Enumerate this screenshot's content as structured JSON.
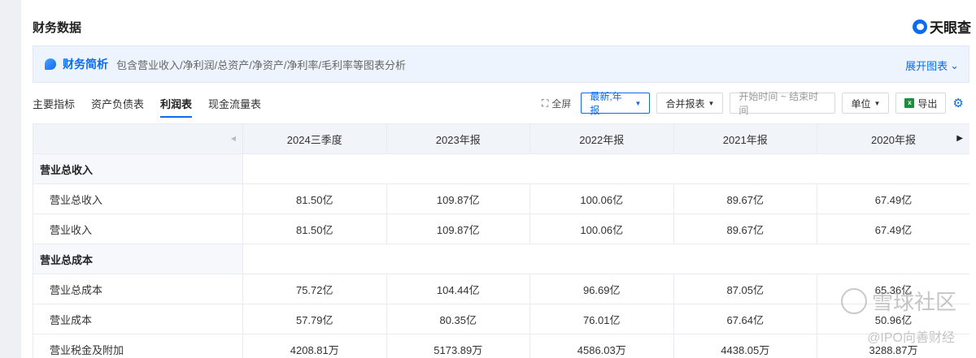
{
  "header": {
    "title": "财务数据",
    "brand": "天眼查"
  },
  "summary": {
    "title": "财务简析",
    "description": "包含营业收入/净利润/总资产/净资产/净利率/毛利率等图表分析",
    "expand_label": "展开图表"
  },
  "tabs": [
    {
      "label": "主要指标",
      "active": false
    },
    {
      "label": "资产负债表",
      "active": false
    },
    {
      "label": "利润表",
      "active": true
    },
    {
      "label": "现金流量表",
      "active": false
    }
  ],
  "toolbar": {
    "fullscreen_label": "全屏",
    "period_label": "最新,年报",
    "statement_label": "合并报表",
    "date_range_placeholder": "开始时间 ~ 结束时间",
    "unit_label": "单位",
    "export_label": "导出"
  },
  "table": {
    "columns": [
      "2024三季度",
      "2023年报",
      "2022年报",
      "2021年报",
      "2020年报"
    ],
    "rows": [
      {
        "group": true,
        "label": "营业总收入"
      },
      {
        "label": "营业总收入",
        "values": [
          "81.50亿",
          "109.87亿",
          "100.06亿",
          "89.67亿",
          "67.49亿"
        ]
      },
      {
        "label": "营业收入",
        "values": [
          "81.50亿",
          "109.87亿",
          "100.06亿",
          "89.67亿",
          "67.49亿"
        ]
      },
      {
        "group": true,
        "label": "营业总成本"
      },
      {
        "label": "营业总成本",
        "values": [
          "75.72亿",
          "104.44亿",
          "96.69亿",
          "87.05亿",
          "65.36亿"
        ]
      },
      {
        "label": "营业成本",
        "values": [
          "57.79亿",
          "80.35亿",
          "76.01亿",
          "67.64亿",
          "50.96亿"
        ]
      },
      {
        "label": "营业税金及附加",
        "values": [
          "4208.81万",
          "5173.89万",
          "4586.03万",
          "4438.05万",
          "3288.87万"
        ]
      }
    ]
  },
  "watermark": {
    "main": "雪球社区",
    "sub": "@IPO向善财经"
  }
}
